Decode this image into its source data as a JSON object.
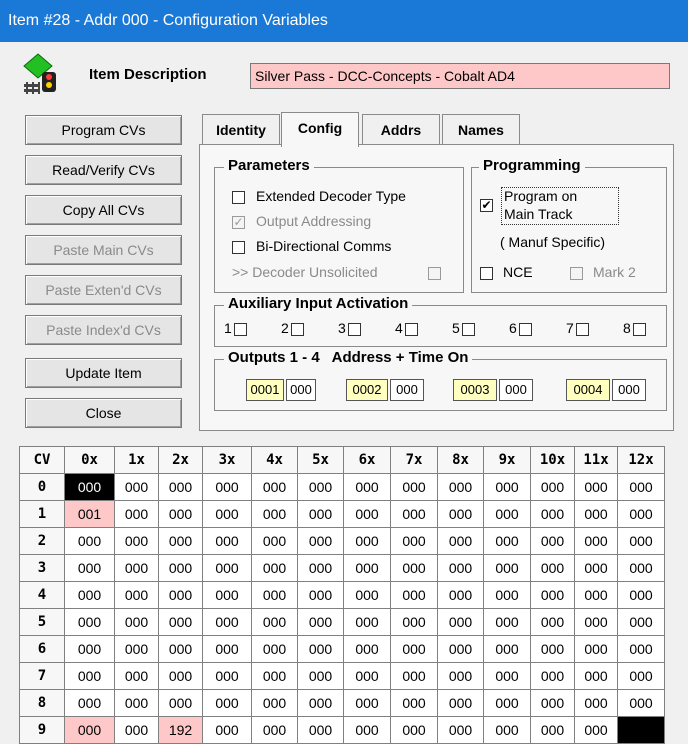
{
  "window": {
    "title": "Item #28 - Addr 000 - Configuration Variables"
  },
  "header": {
    "description_label": "Item Description",
    "description_value": "Silver Pass - DCC-Concepts - Cobalt AD4"
  },
  "buttons": [
    {
      "label": "Program CVs",
      "enabled": true
    },
    {
      "label": "Read/Verify CVs",
      "enabled": true
    },
    {
      "label": "Copy All CVs",
      "enabled": true
    },
    {
      "label": "Paste Main CVs",
      "enabled": false
    },
    {
      "label": "Paste Exten'd CVs",
      "enabled": false
    },
    {
      "label": "Paste Index'd CVs",
      "enabled": false
    },
    {
      "label": "Update Item",
      "enabled": true
    },
    {
      "label": "Close",
      "enabled": true
    }
  ],
  "tabs": [
    "Identity",
    "Config",
    "Addrs",
    "Names"
  ],
  "active_tab": "Config",
  "parameters": {
    "title": "Parameters",
    "extended": "Extended Decoder Type",
    "output_addressing": "Output Addressing",
    "bidirectional": "Bi-Directional Comms",
    "unsolicited": ">> Decoder Unsolicited"
  },
  "programming": {
    "title": "Programming",
    "program_on_main_line1": "Program on",
    "program_on_main_line2": "Main Track",
    "manuf_specific": "( Manuf Specific)",
    "nce": "NCE",
    "mark2": "Mark 2"
  },
  "aux": {
    "title": "Auxiliary Input Activation",
    "inputs": [
      "1",
      "2",
      "3",
      "4",
      "5",
      "6",
      "7",
      "8"
    ]
  },
  "outputs": {
    "title": "Outputs 1 - 4   Address + Time On",
    "items": [
      {
        "addr": "0001",
        "time": "000"
      },
      {
        "addr": "0002",
        "time": "000"
      },
      {
        "addr": "0003",
        "time": "000"
      },
      {
        "addr": "0004",
        "time": "000"
      }
    ]
  },
  "cv_table": {
    "corner": "CV",
    "columns": [
      "0x",
      "1x",
      "2x",
      "3x",
      "4x",
      "5x",
      "6x",
      "7x",
      "8x",
      "9x",
      "10x",
      "11x",
      "12x"
    ],
    "rows": [
      {
        "label": "0",
        "cells": [
          "000",
          "000",
          "000",
          "000",
          "000",
          "000",
          "000",
          "000",
          "000",
          "000",
          "000",
          "000",
          "000"
        ]
      },
      {
        "label": "1",
        "cells": [
          "001",
          "000",
          "000",
          "000",
          "000",
          "000",
          "000",
          "000",
          "000",
          "000",
          "000",
          "000",
          "000"
        ]
      },
      {
        "label": "2",
        "cells": [
          "000",
          "000",
          "000",
          "000",
          "000",
          "000",
          "000",
          "000",
          "000",
          "000",
          "000",
          "000",
          "000"
        ]
      },
      {
        "label": "3",
        "cells": [
          "000",
          "000",
          "000",
          "000",
          "000",
          "000",
          "000",
          "000",
          "000",
          "000",
          "000",
          "000",
          "000"
        ]
      },
      {
        "label": "4",
        "cells": [
          "000",
          "000",
          "000",
          "000",
          "000",
          "000",
          "000",
          "000",
          "000",
          "000",
          "000",
          "000",
          "000"
        ]
      },
      {
        "label": "5",
        "cells": [
          "000",
          "000",
          "000",
          "000",
          "000",
          "000",
          "000",
          "000",
          "000",
          "000",
          "000",
          "000",
          "000"
        ]
      },
      {
        "label": "6",
        "cells": [
          "000",
          "000",
          "000",
          "000",
          "000",
          "000",
          "000",
          "000",
          "000",
          "000",
          "000",
          "000",
          "000"
        ]
      },
      {
        "label": "7",
        "cells": [
          "000",
          "000",
          "000",
          "000",
          "000",
          "000",
          "000",
          "000",
          "000",
          "000",
          "000",
          "000",
          "000"
        ]
      },
      {
        "label": "8",
        "cells": [
          "000",
          "000",
          "000",
          "000",
          "000",
          "000",
          "000",
          "000",
          "000",
          "000",
          "000",
          "000",
          "000"
        ]
      },
      {
        "label": "9",
        "cells": [
          "000",
          "000",
          "192",
          "000",
          "000",
          "000",
          "000",
          "000",
          "000",
          "000",
          "000",
          "000",
          ""
        ]
      }
    ]
  }
}
